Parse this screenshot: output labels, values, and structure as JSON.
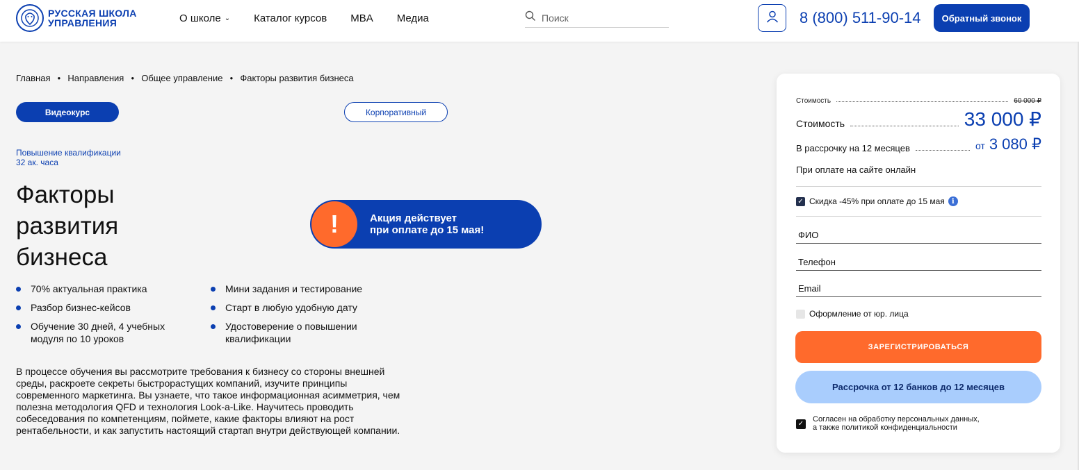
{
  "header": {
    "logo_line1": "РУССКАЯ ШКОЛА",
    "logo_line2": "УПРАВЛЕНИЯ",
    "nav": [
      "О школе",
      "Каталог курсов",
      "MBA",
      "Медиа"
    ],
    "search_placeholder": "Поиск",
    "phone": "8 (800) 511-90-14",
    "callback_label": "Обратный звонок"
  },
  "breadcrumb": [
    "Главная",
    "Направления",
    "Общее управление",
    "Факторы развития бизнеса"
  ],
  "tags": {
    "video": "Видеокурс",
    "corporate": "Корпоративный"
  },
  "qualification": {
    "type": "Повышение квалификации",
    "hours": "32 ак. часа"
  },
  "title": "Факторы развития бизнеса",
  "promo": {
    "icon": "!",
    "text": "Акция действует\nпри оплате до 15 мая!"
  },
  "features": [
    "70% актуальная практика",
    "Мини задания и тестирование",
    "Разбор бизнес-кейсов",
    "Старт в любую удобную дату",
    "Обучение 30 дней, 4 учебных модуля по 10 уроков",
    "Удостоверение о повышении квалификации"
  ],
  "description": "В процессе обучения вы рассмотрите требования к бизнесу со стороны внешней среды, раскроете секреты быстрорастущих компаний, изучите принципы современного маркетинга. Вы узнаете, что такое информационная асимметрия, чем полезна методология QFD и технология Look-a-Like. Научитесь проводить собеседования по компетенциям, поймете, какие факторы влияют на рост рентабельности, и как запустить настоящий стартап внутри действующей компании.",
  "form": {
    "old_price_label": "Стоимость",
    "old_price": "60 000 ₽",
    "price_label": "Стоимость",
    "price": "33 000 ₽",
    "installment_label": "В рассрочку на 12 месяцев",
    "installment_prefix": "от",
    "installment_value": "3 080 ₽",
    "online_note": "При оплате на сайте онлайн",
    "discount_label": "Скидка -45% при оплате до 15 мая",
    "fio_placeholder": "ФИО",
    "phone_placeholder": "Телефон",
    "email_placeholder": "Email",
    "legal_entity_label": "Оформление от юр. лица",
    "register_label": "ЗАРЕГИСТРИРОВАТЬСЯ",
    "installment_button": "Рассрочка от 12 банков до 12 месяцев",
    "consent_line1": "Согласен на обработку персональных данных,",
    "consent_line2": "а также политикой конфиденциальности"
  },
  "colors": {
    "brand_blue": "#0b3fb1",
    "accent_orange": "#ff6a2c",
    "light_blue": "#a9cdfd",
    "bg": "#f4f4f4"
  }
}
